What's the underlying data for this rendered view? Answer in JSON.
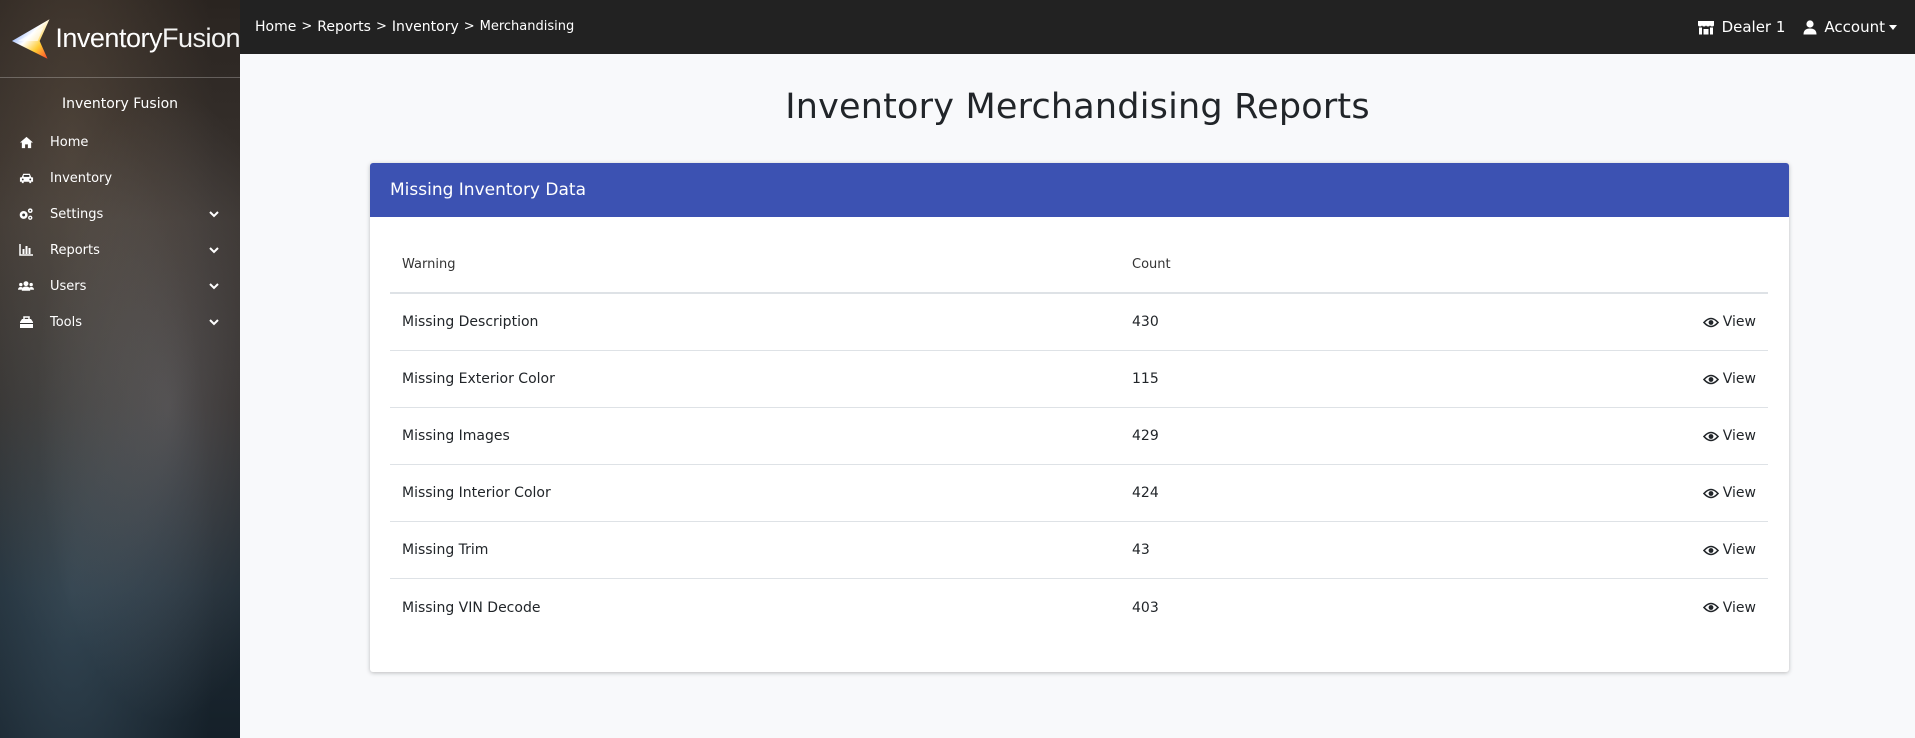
{
  "app": {
    "logo_text_bold": "Inventory",
    "logo_text_light": "Fusion"
  },
  "sidebar": {
    "title": "Inventory Fusion",
    "items": [
      {
        "label": "Home",
        "icon": "home-icon",
        "has_submenu": false
      },
      {
        "label": "Inventory",
        "icon": "car-icon",
        "has_submenu": false
      },
      {
        "label": "Settings",
        "icon": "cogs-icon",
        "has_submenu": true
      },
      {
        "label": "Reports",
        "icon": "chart-bar-icon",
        "has_submenu": true
      },
      {
        "label": "Users",
        "icon": "users-icon",
        "has_submenu": true
      },
      {
        "label": "Tools",
        "icon": "toolbox-icon",
        "has_submenu": true
      }
    ]
  },
  "topbar": {
    "breadcrumb": [
      "Home",
      "Reports",
      "Inventory",
      "Merchandising"
    ],
    "separator": ">",
    "dealer_label": "Dealer 1",
    "account_label": "Account"
  },
  "main": {
    "title": "Inventory Merchandising Reports",
    "panel": {
      "title": "Missing Inventory Data",
      "columns": [
        "Warning",
        "Count",
        ""
      ],
      "view_label": "View",
      "rows": [
        {
          "warning": "Missing Description",
          "count": "430"
        },
        {
          "warning": "Missing Exterior Color",
          "count": "115"
        },
        {
          "warning": "Missing Images",
          "count": "429"
        },
        {
          "warning": "Missing Interior Color",
          "count": "424"
        },
        {
          "warning": "Missing Trim",
          "count": "43"
        },
        {
          "warning": "Missing VIN Decode",
          "count": "403"
        }
      ]
    }
  },
  "colors": {
    "panel_header": "#3c52b2",
    "topbar": "#222222",
    "page_bg": "#f8f9fb"
  }
}
